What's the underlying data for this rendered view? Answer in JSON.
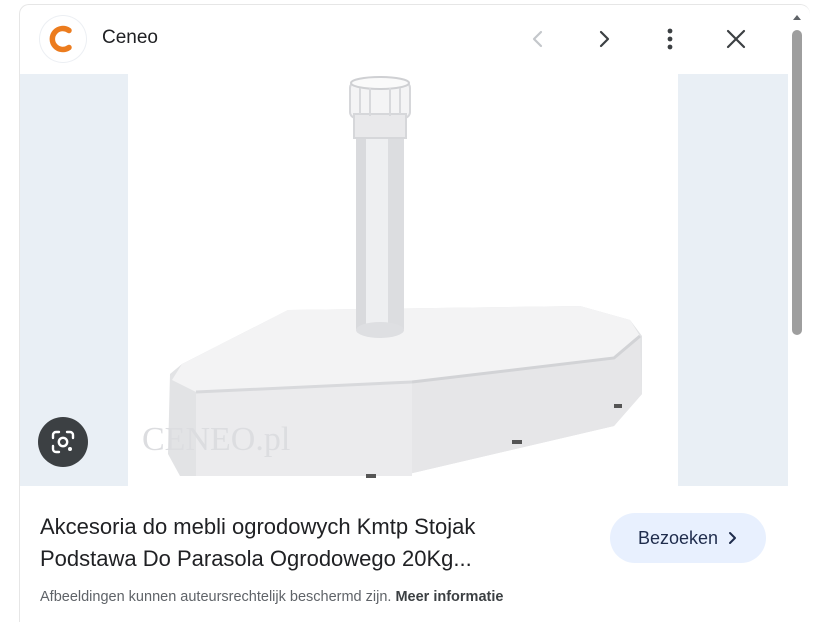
{
  "header": {
    "site_name": "Ceneo",
    "favicon_letter": "C",
    "favicon_color": "#ec7c1e",
    "prev_icon": "chevron-left-icon",
    "next_icon": "chevron-right-icon",
    "more_icon": "more-vert-icon",
    "close_icon": "close-icon"
  },
  "image": {
    "description_icon": "google-lens-icon",
    "watermark": "CENEO.pl"
  },
  "result": {
    "title_line1": "Akcesoria do mebli ogrodowych Kmtp Stojak",
    "title_line2": "Podstawa Do Parasola Ogrodowego 20Kg...",
    "visit_label": "Bezoeken",
    "visit_icon": "chevron-right-icon"
  },
  "notice": {
    "text": "Afbeeldingen kunnen auteursrechtelijk beschermd zijn.",
    "link": "Meer informatie"
  },
  "colors": {
    "visit_bg": "#e8f0fe",
    "image_bg": "#e9eff5",
    "lens_bg": "#3c4043"
  }
}
